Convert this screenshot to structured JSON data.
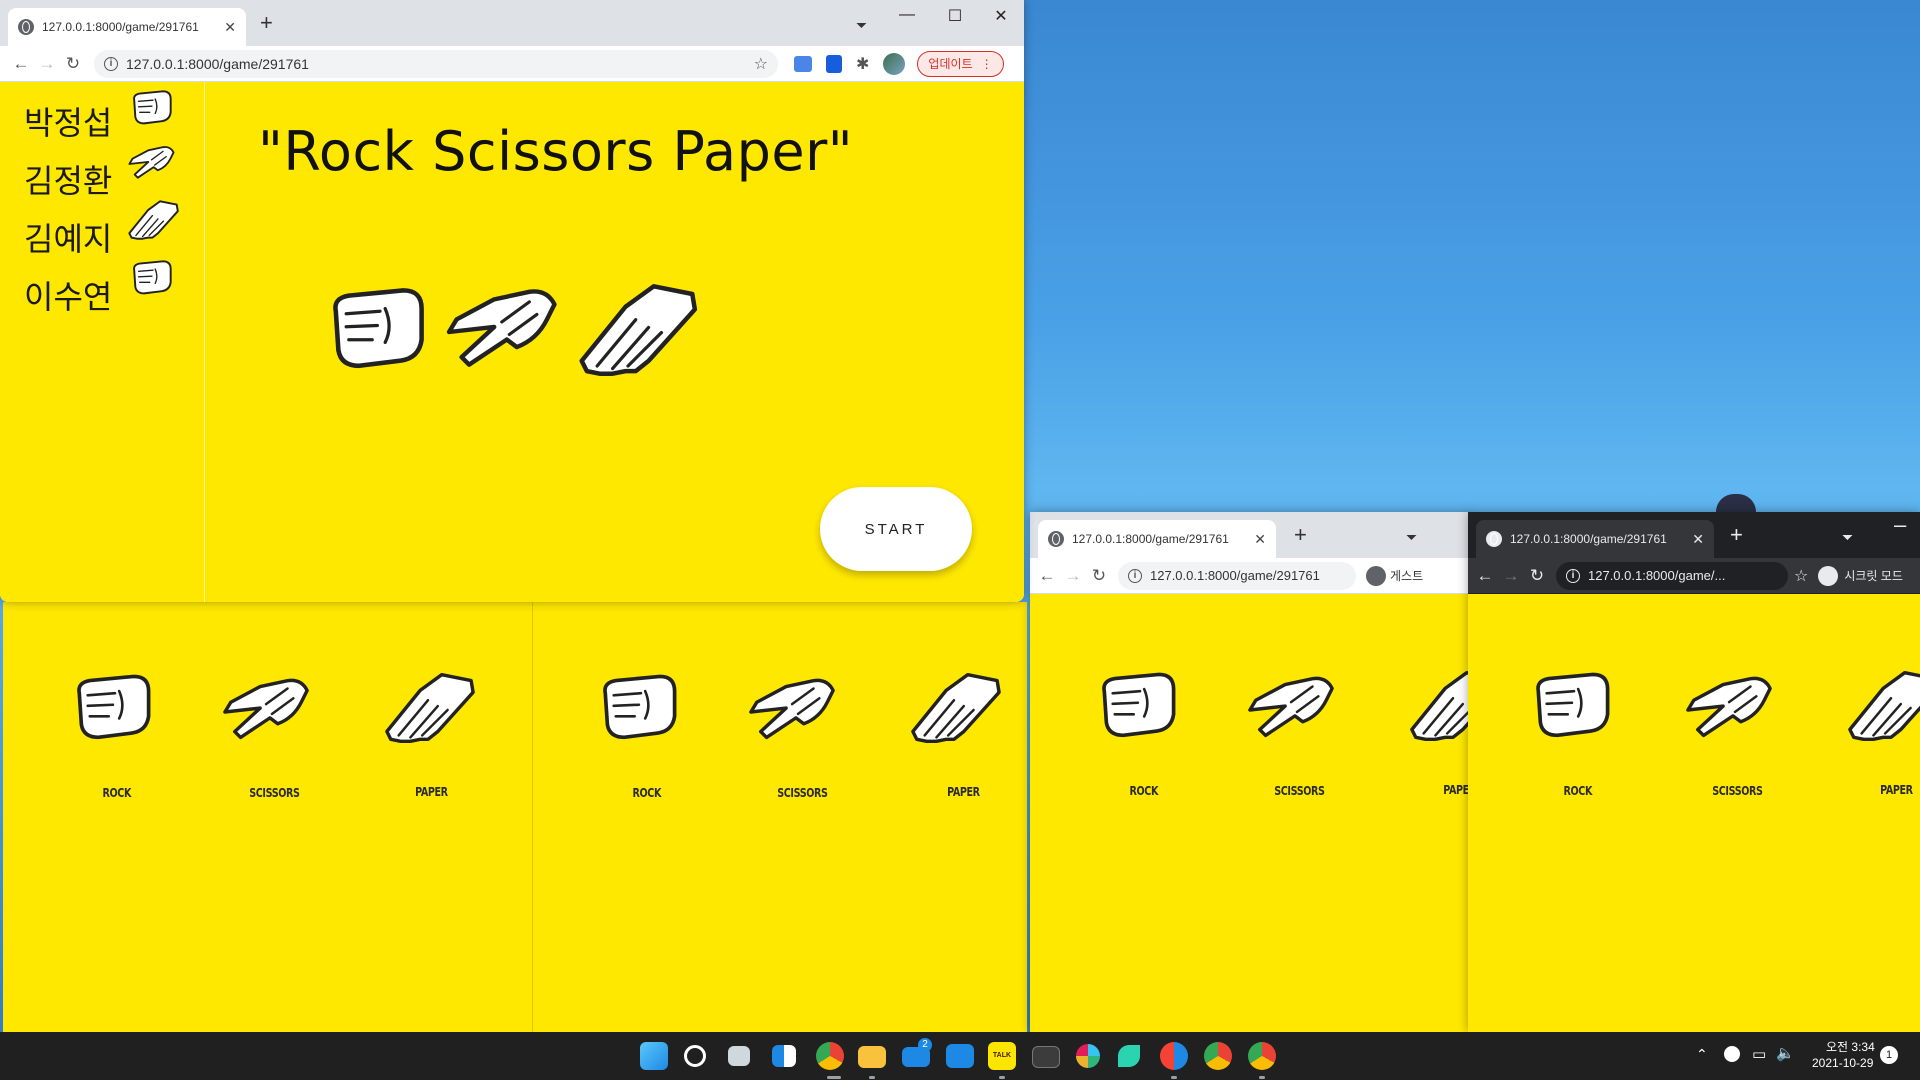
{
  "main_window": {
    "tab_title": "127.0.0.1:8000/game/291761",
    "url": "127.0.0.1:8000/game/291761",
    "update_button": "업데이트",
    "players": [
      "박정섭",
      "김정환",
      "김예지",
      "이수연"
    ],
    "title": "\"Rock Scissors Paper\"",
    "start_label": "START"
  },
  "window_b": {
    "tab_title": "127.0.0.1:8000/game/291761",
    "url": "127.0.0.1:8000/game/291761",
    "profile_label": "게스트"
  },
  "window_c": {
    "tab_title": "127.0.0.1:8000/game/291761",
    "url": "127.0.0.1:8000/game/...",
    "profile_label": "시크릿 모드"
  },
  "choices": {
    "rock": "ROCK",
    "scissors": "SCISSORS",
    "paper": "PAPER",
    "paper_clipped": "PAPE"
  },
  "taskbar": {
    "time": "오전 3:34",
    "date": "2021-10-29",
    "mail_badge": "2",
    "kakao_label": "TALK",
    "notification_count": "1"
  },
  "colors": {
    "page_yellow": "#ffe800",
    "chrome_tab_bg": "#dee1e6",
    "incognito_bg": "#202124"
  }
}
